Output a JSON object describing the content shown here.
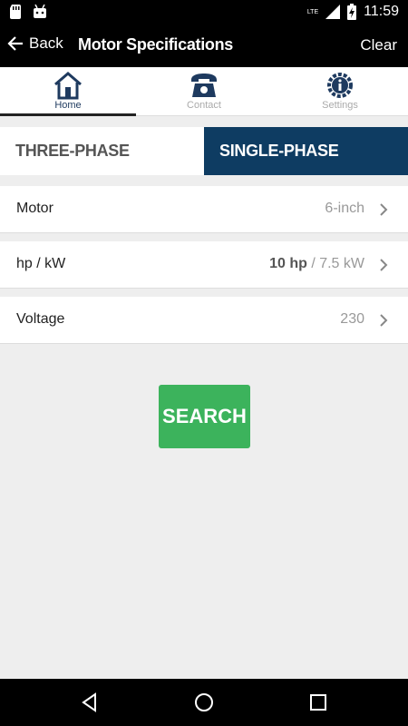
{
  "status_bar": {
    "time": "11:59",
    "network": "LTE",
    "icons": [
      "sd-card-icon",
      "android-icon",
      "signal-icon",
      "battery-charging-icon"
    ]
  },
  "app_bar": {
    "back_label": "Back",
    "title": "Motor Specifications",
    "clear_label": "Clear"
  },
  "tabs": [
    {
      "label": "Home",
      "icon": "house-icon",
      "active": true
    },
    {
      "label": "Contact",
      "icon": "phone-icon",
      "active": false
    },
    {
      "label": "Settings",
      "icon": "gear-info-icon",
      "active": false
    }
  ],
  "phase": {
    "three_phase": "THREE-PHASE",
    "single_phase": "SINGLE-PHASE",
    "selected": "SINGLE-PHASE"
  },
  "fields": {
    "motor": {
      "label": "Motor",
      "value": "6-inch"
    },
    "power": {
      "label": "hp / kW",
      "hp": "10 hp",
      "kw": " / 7.5 kW"
    },
    "voltage": {
      "label": "Voltage",
      "value": "230"
    }
  },
  "search_label": "SEARCH",
  "colors": {
    "navy": "#0e3c62",
    "green": "#3cb35c",
    "background": "#eeeeee"
  }
}
